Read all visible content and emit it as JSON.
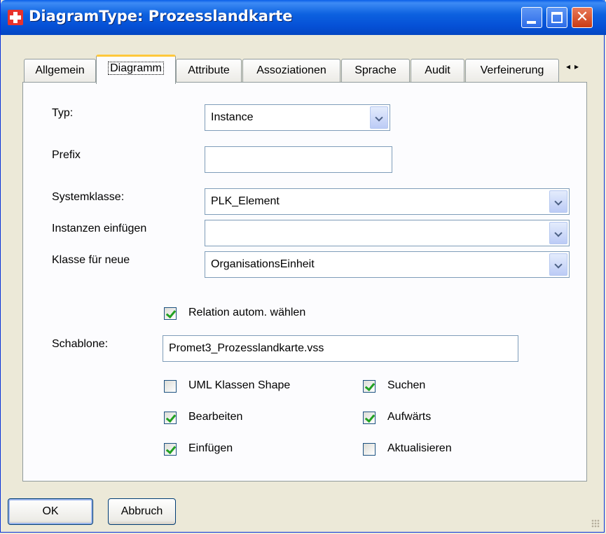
{
  "window": {
    "title": "DiagramType: Prozesslandkarte"
  },
  "tabs": [
    {
      "label": "Allgemein"
    },
    {
      "label": "Diagramm"
    },
    {
      "label": "Attribute"
    },
    {
      "label": "Assoziationen"
    },
    {
      "label": "Sprache"
    },
    {
      "label": "Audit"
    },
    {
      "label": "Verfeinerung"
    }
  ],
  "form": {
    "typ": {
      "label": "Typ:",
      "value": "Instance"
    },
    "prefix": {
      "label": "Prefix",
      "value": ""
    },
    "systemklasse": {
      "label": "Systemklasse:",
      "value": "PLK_Element"
    },
    "instanzen": {
      "label": "Instanzen einfügen",
      "value": ""
    },
    "klasse": {
      "label": "Klasse für neue",
      "value": "OrganisationsEinheit"
    },
    "relation": {
      "label": "Relation autom. wählen",
      "checked": true
    },
    "schablone": {
      "label": "Schablone:",
      "value": "Promet3_Prozesslandkarte.vss"
    },
    "checkboxes": {
      "uml": {
        "label": "UML Klassen Shape",
        "checked": false
      },
      "bearbeiten": {
        "label": "Bearbeiten",
        "checked": true
      },
      "einfuegen": {
        "label": "Einfügen",
        "checked": true
      },
      "suchen": {
        "label": "Suchen",
        "checked": true
      },
      "aufwaerts": {
        "label": "Aufwärts",
        "checked": true
      },
      "aktualisieren": {
        "label": "Aktualisieren",
        "checked": false
      }
    }
  },
  "buttons": {
    "ok": "OK",
    "cancel": "Abbruch"
  },
  "icons": {
    "app": "red-cross-icon",
    "tab_scroll": "tab-scroll-arrows-icon"
  },
  "colors": {
    "titlebar": "#0550d6",
    "check": "#21a121",
    "face": "#ece9d8"
  }
}
